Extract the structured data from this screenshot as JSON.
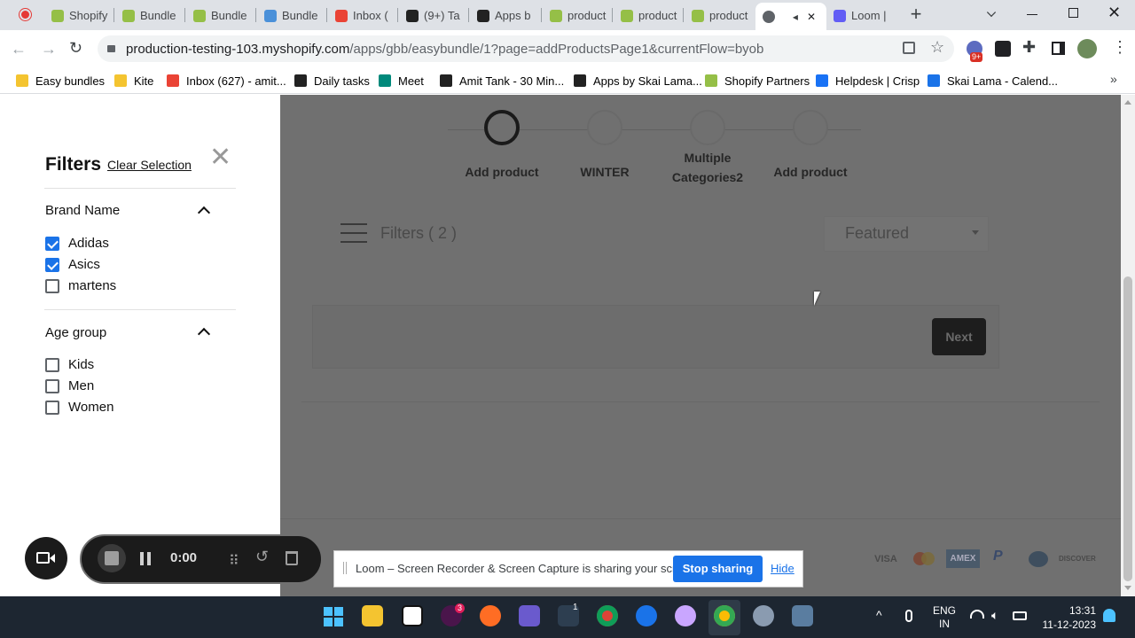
{
  "browser": {
    "tabs": [
      {
        "label": "Shopify",
        "color": "#95bf47"
      },
      {
        "label": "Bundle",
        "color": "#95bf47"
      },
      {
        "label": "Bundle",
        "color": "#95bf47"
      },
      {
        "label": "Bundle",
        "color": "#4a90d9"
      },
      {
        "label": "Inbox (",
        "color": "#ea4335"
      },
      {
        "label": "(9+) Ta",
        "color": "#222222"
      },
      {
        "label": "Apps b",
        "color": "#222222"
      },
      {
        "label": "product",
        "color": "#95bf47"
      },
      {
        "label": "product",
        "color": "#95bf47"
      },
      {
        "label": "product",
        "color": "#95bf47"
      },
      {
        "label": "",
        "color": "#5f6368"
      },
      {
        "label": "Loom |",
        "color": "#625df5"
      }
    ],
    "url_host": "production-testing-103.myshopify.com",
    "url_path": "/apps/gbb/easybundle/1?page=addProductsPage1&currentFlow=byob",
    "extension_badge": "9+",
    "bookmarks": [
      {
        "label": "Easy bundles",
        "color": "#f4c430"
      },
      {
        "label": "Kite",
        "color": "#f4c430"
      },
      {
        "label": "Inbox (627) - amit...",
        "color": "#ea4335"
      },
      {
        "label": "Daily tasks",
        "color": "#222222"
      },
      {
        "label": "Meet",
        "color": "#00897b"
      },
      {
        "label": "Amit Tank - 30 Min...",
        "color": "#222222"
      },
      {
        "label": "Apps by Skai Lama...",
        "color": "#222222"
      },
      {
        "label": "Shopify Partners",
        "color": "#95bf47"
      },
      {
        "label": "Helpdesk | Crisp",
        "color": "#1972f5"
      },
      {
        "label": "Skai Lama - Calend...",
        "color": "#1a73e8"
      }
    ]
  },
  "filters": {
    "title": "Filters",
    "clear_label": "Clear Selection",
    "groups": [
      {
        "name": "Brand Name",
        "options": [
          {
            "label": "Adidas",
            "checked": true
          },
          {
            "label": "Asics",
            "checked": true
          },
          {
            "label": "martens",
            "checked": false
          }
        ]
      },
      {
        "name": "Age group",
        "options": [
          {
            "label": "Kids",
            "checked": false
          },
          {
            "label": "Men",
            "checked": false
          },
          {
            "label": "Women",
            "checked": false
          }
        ]
      }
    ]
  },
  "steps": [
    {
      "label": "Add product"
    },
    {
      "label": "WINTER"
    },
    {
      "label": "Multiple Categories2"
    },
    {
      "label": "Add product"
    }
  ],
  "toolbar": {
    "filters_label": "Filters ( 2 )",
    "sort_value": "Featured",
    "next_label": "Next"
  },
  "payments": [
    "VISA",
    "AMEX",
    "P",
    "DISCOVER"
  ],
  "loom": {
    "timer": "0:00",
    "share_text": "Loom – Screen Recorder & Screen Capture is sharing your screen.",
    "stop_label": "Stop sharing",
    "hide_label": "Hide"
  },
  "taskbar": {
    "lang_line1": "ENG",
    "lang_line2": "IN",
    "time": "13:31",
    "date": "11-12-2023",
    "slack_badge": "3",
    "app_badge": "1"
  }
}
